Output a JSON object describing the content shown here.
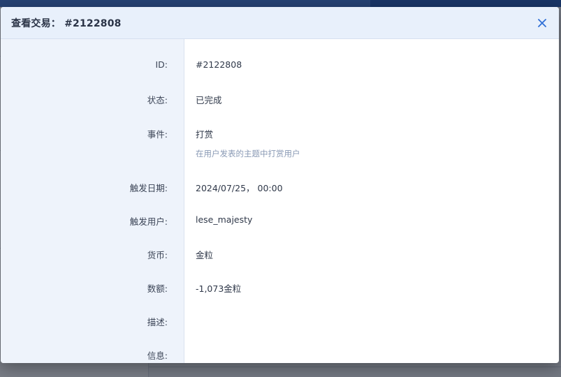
{
  "modal": {
    "title": "查看交易： #2122808",
    "close_icon": "close-icon"
  },
  "details": {
    "id_label": "ID:",
    "id_value": "#2122808",
    "status_label": "状态:",
    "status_value": "已完成",
    "event_label": "事件:",
    "event_value": "打赏",
    "event_desc": "在用户发表的主题中打赏用户",
    "trigger_date_label": "触发日期:",
    "trigger_date_value": "2024/07/25， 00:00",
    "trigger_user_label": "触发用户:",
    "trigger_user_value": "lese_majesty",
    "currency_label": "货币:",
    "currency_value": "金粒",
    "amount_label": "数额:",
    "amount_value": "-1,073金粒",
    "description_label": "描述:",
    "description_value": "",
    "info_label": "信息:",
    "info_value": ""
  },
  "colors": {
    "accent": "#1f57b7",
    "header_bg": "#e8f0fb",
    "label_col_bg": "#eef3fb",
    "muted_text": "#8a9ab5"
  }
}
